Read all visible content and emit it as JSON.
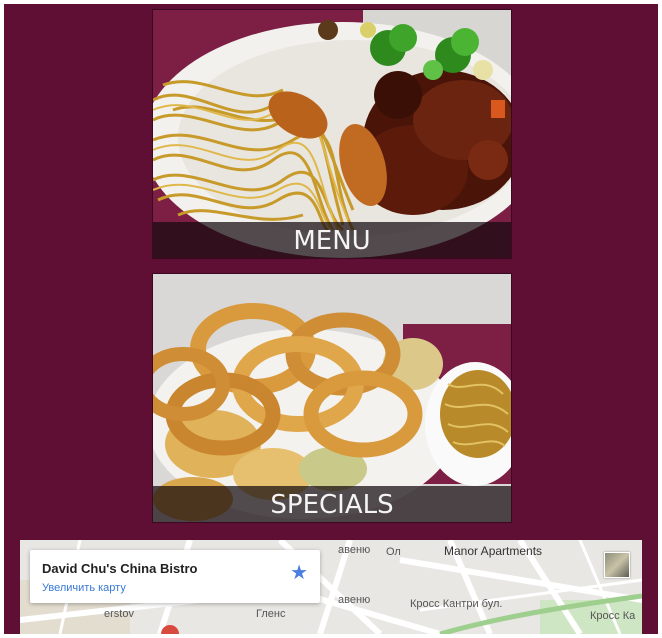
{
  "tiles": {
    "menu_label": "MENU",
    "specials_label": "SPECIALS"
  },
  "map": {
    "place_name": "David Chu's China Bistro",
    "enlarge_link": "Увеличить карту",
    "star_icon": "star-icon",
    "labels": {
      "apartments": "Manor Apartments",
      "street_a": "авеню",
      "street_b": "авеню",
      "street_c": "Гленс",
      "street_d": "Кросс Кантри бул.",
      "street_e": "Кросс Ка",
      "street_f": "Ол",
      "street_g": "erstov"
    }
  },
  "colors": {
    "page_background": "#5e0f33",
    "label_bar": "#1a0e12",
    "link": "#3a78d4",
    "star": "#4a7fe0"
  }
}
